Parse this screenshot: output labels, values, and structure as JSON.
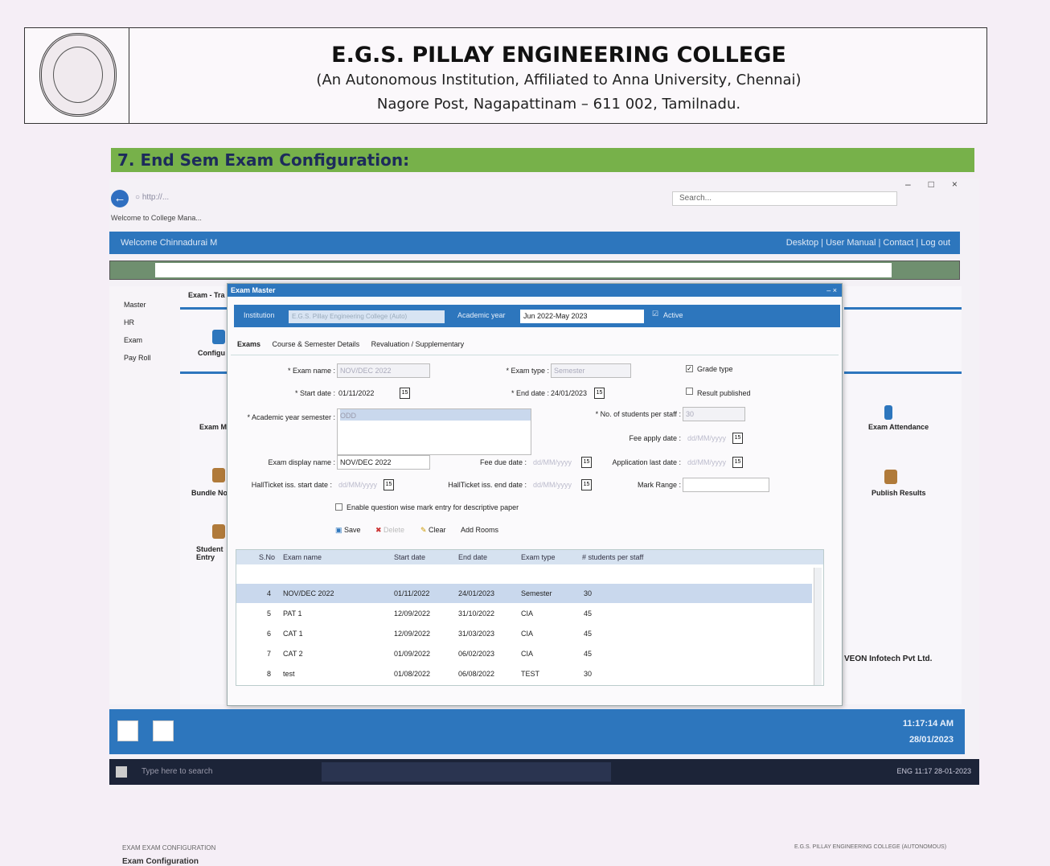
{
  "document": {
    "college_name": "E.G.S. PILLAY ENGINEERING COLLEGE",
    "subtitle": "(An Autonomous Institution, Affiliated to Anna University, Chennai)",
    "address": "Nagore Post, Nagapattinam – 611 002, Tamilnadu.",
    "section_title": "7.  End Sem Exam Configuration:",
    "footer_left": "EXAM   EXAM CONFIGURATION",
    "footer_left_title": "Exam Configuration",
    "footer_right": "E.G.S. PILLAY ENGINEERING COLLEGE (AUTONOMOUS)"
  },
  "browser": {
    "search_placeholder": "Search...",
    "tab_title": "Welcome to College Mana..."
  },
  "app": {
    "welcome": "Welcome Chinnadurai M",
    "top_links": "Desktop | User Manual | Contact | Log out",
    "nav": [
      "Master",
      "HR",
      "Exam",
      "Pay Roll"
    ],
    "breadcrumb": "Exam - Tra",
    "bg_labels": {
      "configure": "Configu",
      "exam_m": "Exam M",
      "bundle_no": "Bundle No",
      "student_entry": "Student Entry",
      "exam_attendance": "Exam Attendance",
      "publish_results": "Publish Results",
      "veon": "VEON Infotech Pvt Ltd."
    },
    "clock_time": "11:17:14 AM",
    "clock_date": "28/01/2023",
    "taskbar_search": "Type here to search",
    "tray_time": "11:17",
    "tray_date": "28-01-2023",
    "tray_lang": "ENG"
  },
  "modal": {
    "title": "Exam Master",
    "institution_label": "Institution",
    "institution_value": "E.G.S. Pillay Engineering College (Auto)",
    "academic_year_label": "Academic year",
    "academic_year_value": "Jun 2022-May 2023",
    "active_label": "Active",
    "tabs": [
      "Exams",
      "Course & Semester Details",
      "Revaluation / Supplementary"
    ],
    "form": {
      "exam_name_label": "* Exam name :",
      "exam_name_value": "NOV/DEC 2022",
      "exam_type_label": "* Exam type :",
      "exam_type_value": "Semester",
      "grade_type_label": "Grade type",
      "start_date_label": "* Start date :",
      "start_date_value": "01/11/2022",
      "end_date_label": "* End date :",
      "end_date_value": "24/01/2023",
      "result_published_label": "Result published",
      "ay_semester_label": "* Academic year semester :",
      "ay_semester_value": "ODD",
      "students_per_staff_label": "* No. of students per staff :",
      "students_per_staff_value": "30",
      "fee_apply_label": "Fee apply date :",
      "date_placeholder": "dd/MM/yyyy",
      "exam_display_label": "Exam display name :",
      "exam_display_value": "NOV/DEC 2022",
      "fee_due_label": "Fee due date :",
      "app_last_label": "Application last date :",
      "hall_start_label": "HallTicket iss. start date :",
      "hall_end_label": "HallTicket iss. end date :",
      "mark_range_label": "Mark Range :",
      "enable_q_label": "Enable question wise mark entry for descriptive paper",
      "cal_icon": "15"
    },
    "buttons": {
      "save": "Save",
      "delete": "Delete",
      "clear": "Clear",
      "add_rooms": "Add Rooms"
    },
    "grid": {
      "headers": [
        "S.No",
        "Exam name",
        "Start date",
        "End date",
        "Exam type",
        "# students per staff"
      ],
      "rows": [
        [
          "4",
          "NOV/DEC 2022",
          "01/11/2022",
          "24/01/2023",
          "Semester",
          "30"
        ],
        [
          "5",
          "PAT 1",
          "12/09/2022",
          "31/10/2022",
          "CIA",
          "45"
        ],
        [
          "6",
          "CAT 1",
          "12/09/2022",
          "31/03/2023",
          "CIA",
          "45"
        ],
        [
          "7",
          "CAT 2",
          "01/09/2022",
          "06/02/2023",
          "CIA",
          "45"
        ],
        [
          "8",
          "test",
          "01/08/2022",
          "06/08/2022",
          "TEST",
          "30"
        ]
      ]
    }
  }
}
